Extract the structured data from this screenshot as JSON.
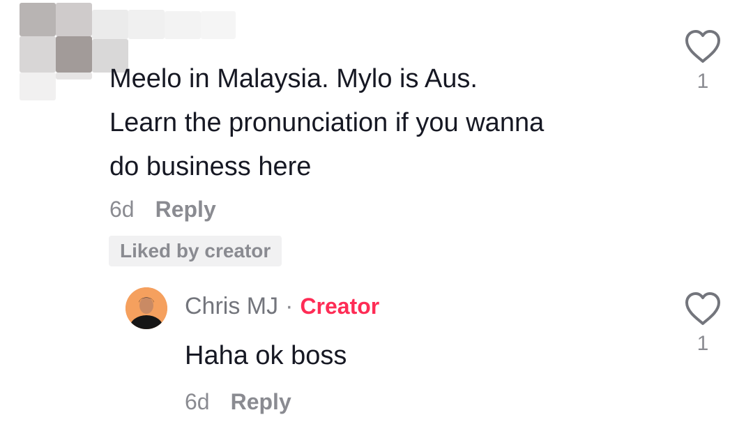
{
  "comment": {
    "lines": [
      "Meelo in Malaysia. Mylo is Aus.",
      "Learn the pronunciation if you wanna",
      "do business here"
    ],
    "time": "6d",
    "reply_label": "Reply",
    "liked_badge": "Liked by creator",
    "like_count": "1"
  },
  "reply": {
    "author": "Chris MJ",
    "separator": "·",
    "author_tag": "Creator",
    "text": "Haha ok boss",
    "time": "6d",
    "reply_label": "Reply",
    "like_count": "1"
  },
  "icons": {
    "like": "heart-outline-icon"
  },
  "colors": {
    "creator_accent": "#fe2c55",
    "muted": "#8a8b91",
    "text": "#161823"
  }
}
